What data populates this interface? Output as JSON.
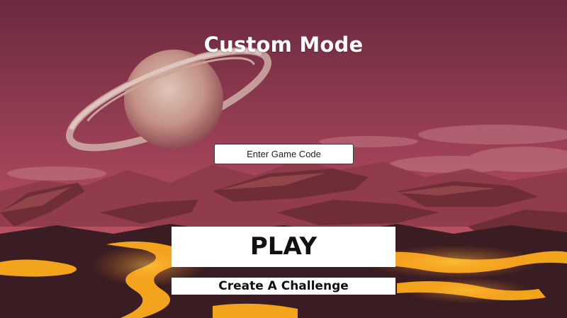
{
  "screen": {
    "title": "Custom Mode"
  },
  "code_input": {
    "placeholder": "Enter Game Code",
    "value": ""
  },
  "buttons": {
    "play_label": "PLAY",
    "challenge_label": "Create A Challenge"
  },
  "colors": {
    "sky_top": "#6e2b3f",
    "sky_mid": "#a44659",
    "planet": "#d6b9a8",
    "rock": "#7a3438",
    "lava": "#f2a51c",
    "button_bg": "#ffffff",
    "button_text": "#111111"
  }
}
